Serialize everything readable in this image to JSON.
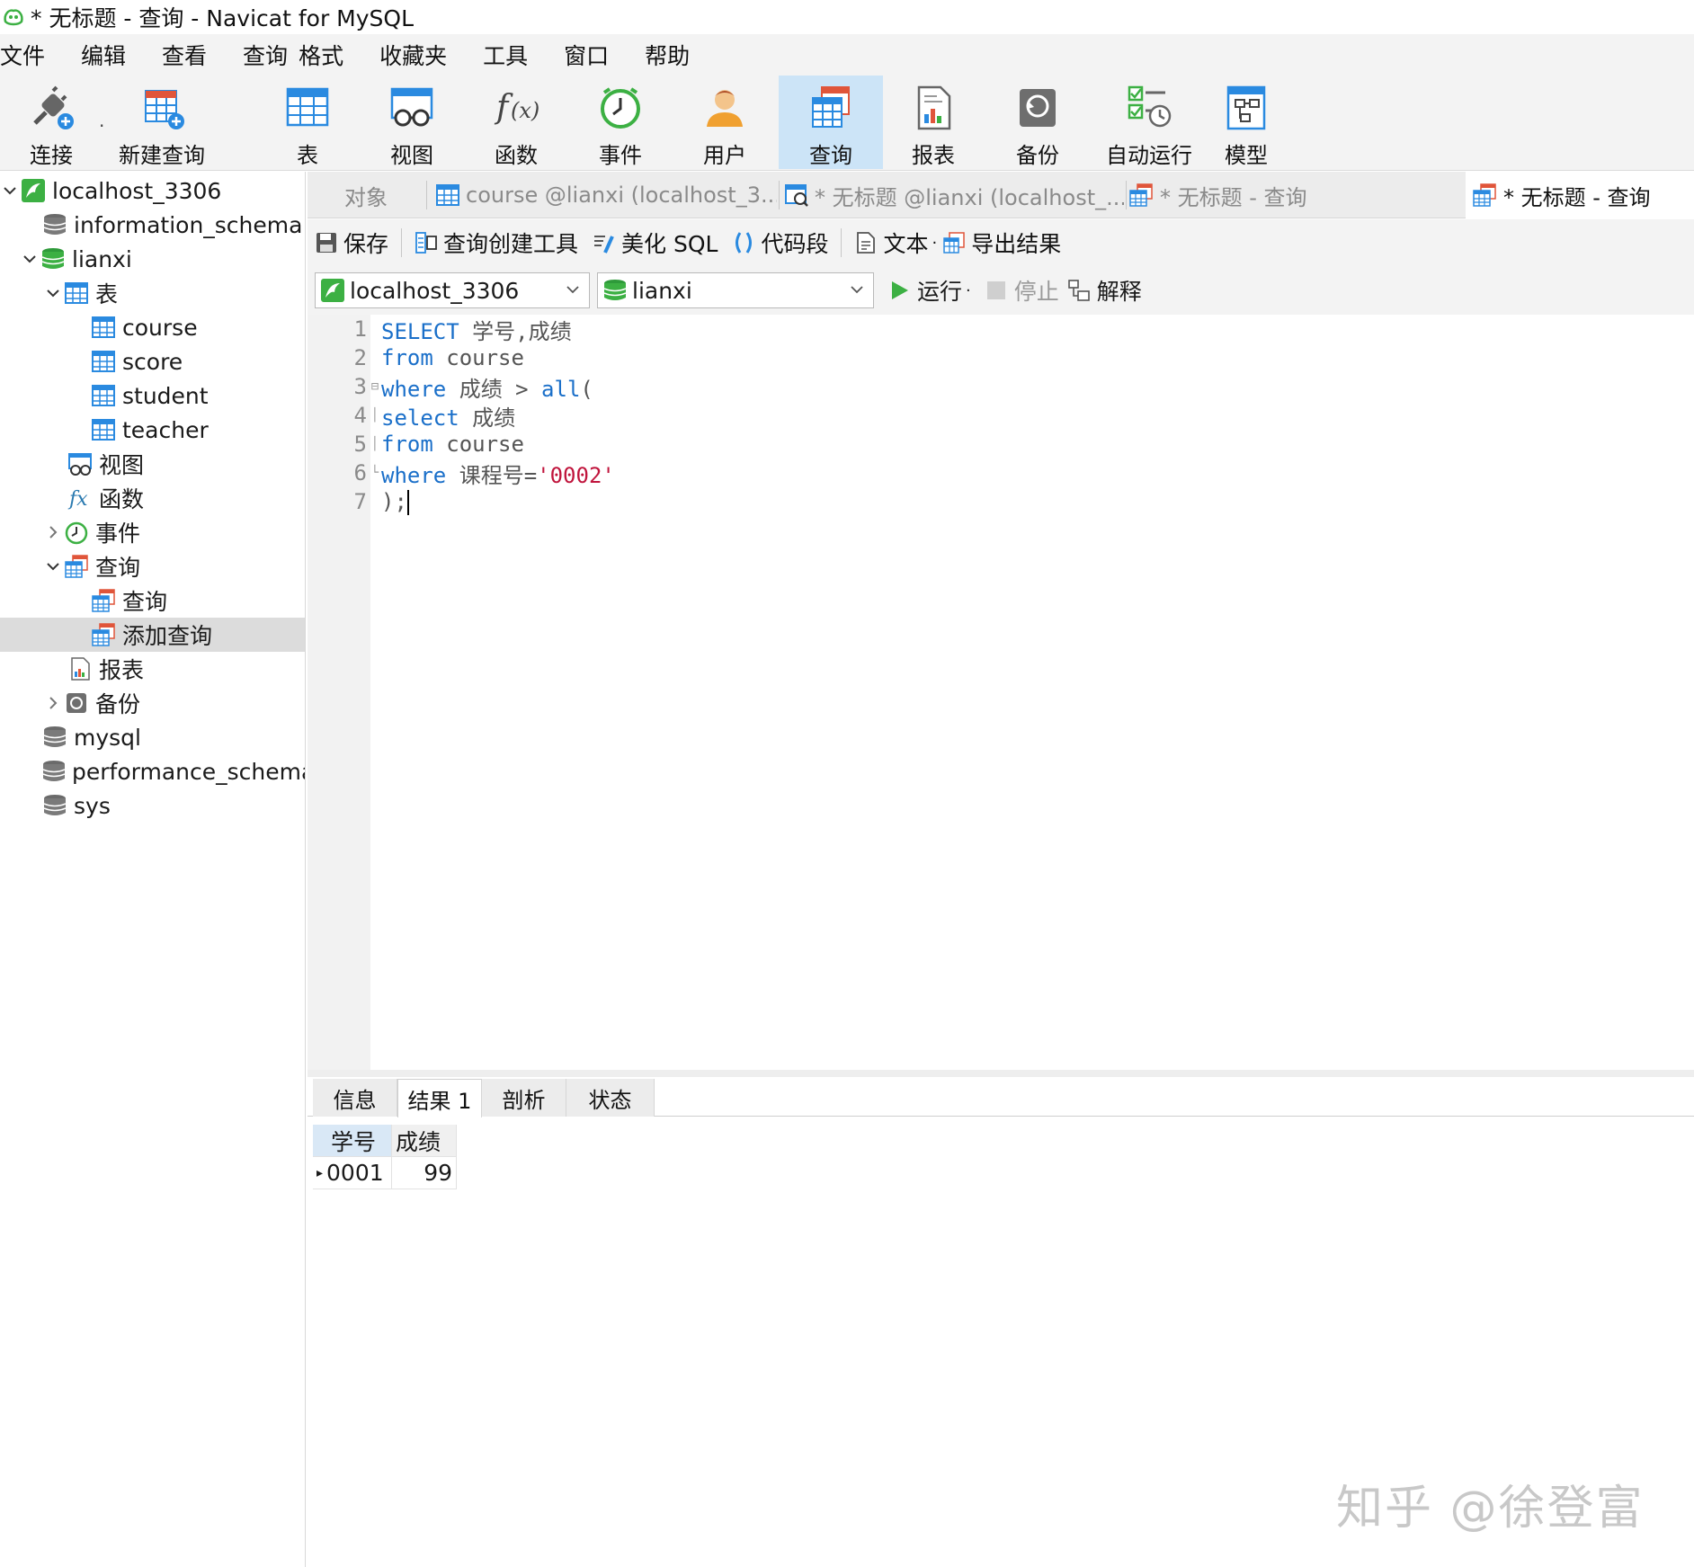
{
  "window": {
    "title": "* 无标题 - 查询 - Navicat for MySQL"
  },
  "menu": [
    "文件",
    "编辑",
    "查看",
    "查询",
    "格式",
    "收藏夹",
    "工具",
    "窗口",
    "帮助"
  ],
  "toolbar": {
    "connect": "连接",
    "new_query": "新建查询",
    "table": "表",
    "view": "视图",
    "function": "函数",
    "event": "事件",
    "user": "用户",
    "query": "查询",
    "report": "报表",
    "backup": "备份",
    "autorun": "自动运行",
    "model": "模型"
  },
  "tree": {
    "connection": "localhost_3306",
    "info_schema": "information_schema",
    "lianxi": "lianxi",
    "tables": "表",
    "t_course": "course",
    "t_score": "score",
    "t_student": "student",
    "t_teacher": "teacher",
    "views": "视图",
    "functions": "函数",
    "events": "事件",
    "queries": "查询",
    "q_query": "查询",
    "q_add": "添加查询",
    "reports": "报表",
    "backups": "备份",
    "mysql": "mysql",
    "perf_schema": "performance_schema",
    "sys": "sys"
  },
  "tabs": {
    "objects": "对象",
    "tab1": "course @lianxi (localhost_3...",
    "tab2": "* 无标题 @lianxi (localhost_...",
    "tab3": "* 无标题 - 查询",
    "tab4": "* 无标题 - 查询"
  },
  "editor_toolbar": {
    "save": "保存",
    "query_builder": "查询创建工具",
    "beautify": "美化 SQL",
    "snippet": "代码段",
    "text": "文本",
    "export": "导出结果"
  },
  "connbar": {
    "connection": "localhost_3306",
    "database": "lianxi",
    "run": "运行",
    "stop": "停止",
    "explain": "解释"
  },
  "sql": {
    "l1": "1",
    "l2": "2",
    "l3": "3",
    "l4": "4",
    "l5": "5",
    "l6": "6",
    "l7": "7",
    "kw_select1": "SELECT",
    "t1": " 学号,成绩",
    "kw_from1": "from",
    "t2": " course",
    "kw_where1": "where",
    "t3a": " 成绩 > ",
    "kw_all": "all",
    "t3b": "(",
    "kw_select2": "select",
    "t4": " 成绩",
    "kw_from2": "from",
    "t5": " course",
    "kw_where2": "where",
    "t6": " 课程号=",
    "s6": "'0002'",
    "t7": ");"
  },
  "result_tabs": {
    "info": "信息",
    "result1": "结果 1",
    "profile": "剖析",
    "status": "状态"
  },
  "result": {
    "col1": "学号",
    "col2": "成绩",
    "r1c1": "0001",
    "r1c2": "99"
  },
  "watermark": "知乎 @徐登富",
  "colors": {
    "accent": "#cce4f7",
    "keyword": "#1a6fc9",
    "string": "#c0143c",
    "brand_green": "#3cb043"
  }
}
